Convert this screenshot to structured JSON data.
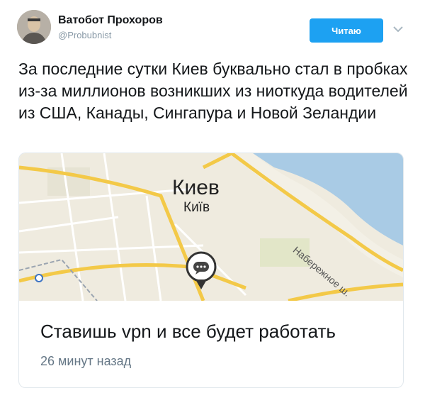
{
  "tweet": {
    "author_name": "Ватобот Прохоров",
    "author_handle": "@Probubnist",
    "follow_label": "Читаю",
    "text": "За последние сутки Киев буквально стал в пробках из-за миллионов возникших из ниоткуда водителей из США, Канады, Сингапура и Новой Зеландии"
  },
  "card": {
    "map": {
      "city_ru": "Киев",
      "city_uk": "Київ",
      "street_label": "Набережное ш."
    },
    "title": "Ставишь vpn и все будет работать",
    "meta": "26 минут назад"
  },
  "colors": {
    "accent": "#1da1f2",
    "water": "#a9cbe5",
    "road": "#f3c948"
  },
  "icons": {
    "avatar": "user-avatar",
    "more": "chevron-down-icon",
    "map_pin": "speech-bubble-pin-icon"
  }
}
